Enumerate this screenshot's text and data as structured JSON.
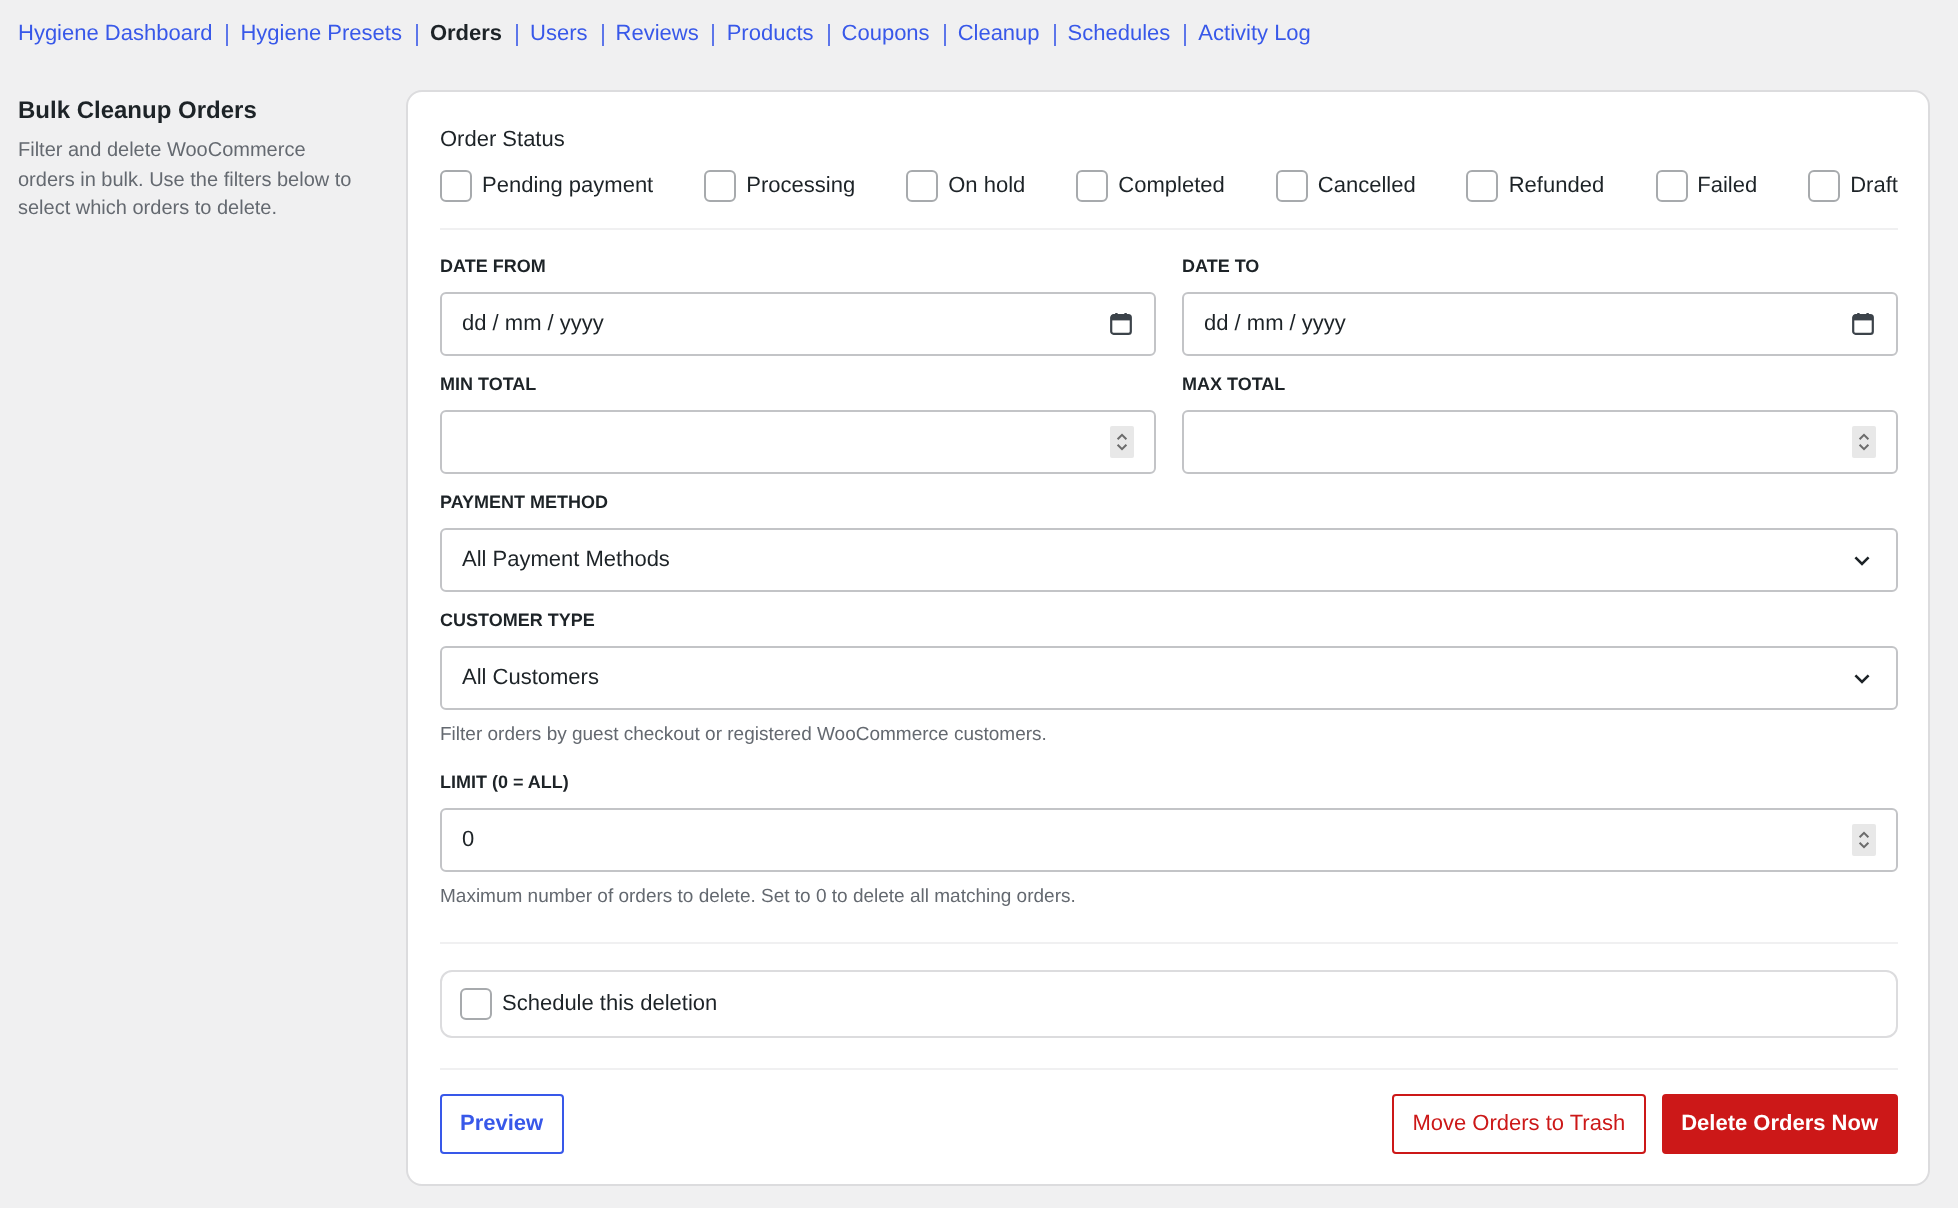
{
  "nav": [
    {
      "label": "Hygiene Dashboard",
      "selected": false
    },
    {
      "label": "Hygiene Presets",
      "selected": false
    },
    {
      "label": "Orders",
      "selected": true
    },
    {
      "label": "Users",
      "selected": false
    },
    {
      "label": "Reviews",
      "selected": false
    },
    {
      "label": "Products",
      "selected": false
    },
    {
      "label": "Coupons",
      "selected": false
    },
    {
      "label": "Cleanup",
      "selected": false
    },
    {
      "label": "Schedules",
      "selected": false
    },
    {
      "label": "Activity Log",
      "selected": false
    }
  ],
  "sidebar": {
    "title": "Bulk Cleanup Orders",
    "description": "Filter and delete WooCommerce orders in bulk. Use the filters below to select which orders to delete."
  },
  "form": {
    "order_status": {
      "label": "Order Status",
      "options": [
        {
          "label": "Pending payment",
          "checked": false
        },
        {
          "label": "Processing",
          "checked": false
        },
        {
          "label": "On hold",
          "checked": false
        },
        {
          "label": "Completed",
          "checked": false
        },
        {
          "label": "Cancelled",
          "checked": false
        },
        {
          "label": "Refunded",
          "checked": false
        },
        {
          "label": "Failed",
          "checked": false
        },
        {
          "label": "Draft",
          "checked": false
        }
      ]
    },
    "rows": [
      {
        "fields": [
          {
            "kind": "date",
            "label": "DATE FROM",
            "placeholder": "dd / mm / yyyy"
          },
          {
            "kind": "date",
            "label": "DATE TO",
            "placeholder": "dd / mm / yyyy"
          }
        ]
      },
      {
        "fields": [
          {
            "kind": "number",
            "label": "MIN TOTAL"
          },
          {
            "kind": "number",
            "label": "MAX TOTAL"
          }
        ]
      },
      {
        "fields": [
          {
            "kind": "select",
            "label": "PAYMENT METHOD",
            "value": "All Payment Methods"
          }
        ]
      },
      {
        "fields": [
          {
            "kind": "select",
            "label": "CUSTOMER TYPE",
            "value": "All Customers",
            "help": "Filter orders by guest checkout or registered WooCommerce customers."
          }
        ]
      },
      {
        "fields": [
          {
            "kind": "number",
            "label": "LIMIT (0 = ALL)",
            "value": "0",
            "help": "Maximum number of orders to delete. Set to 0 to delete all matching orders."
          }
        ]
      }
    ],
    "schedule": {
      "label": "Schedule this deletion",
      "checked": false
    },
    "actions": {
      "start": [
        {
          "kind": "secondary",
          "label": "Preview"
        }
      ],
      "end": [
        {
          "kind": "outline-danger",
          "label": "Move Orders to Trash"
        },
        {
          "kind": "danger",
          "label": "Delete Orders Now"
        }
      ]
    }
  }
}
